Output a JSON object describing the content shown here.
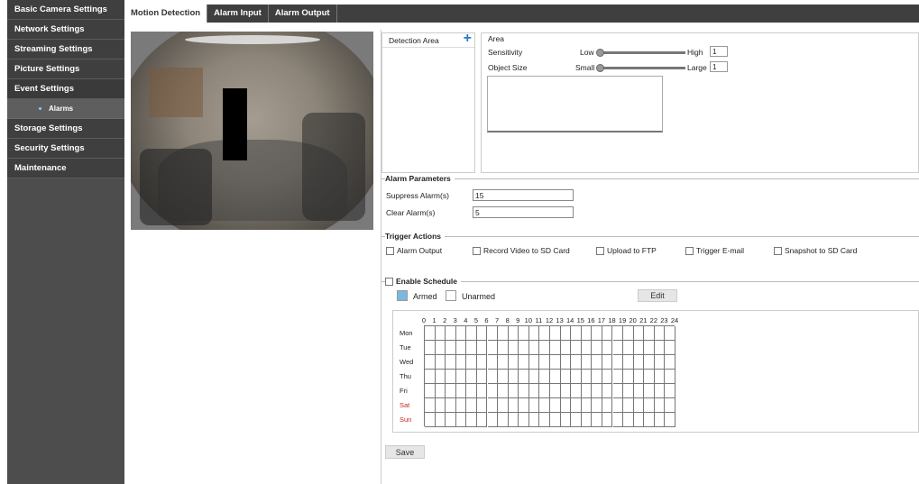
{
  "sidebar": {
    "items": [
      {
        "label": "Basic Camera Settings"
      },
      {
        "label": "Network Settings"
      },
      {
        "label": "Streaming Settings"
      },
      {
        "label": "Picture Settings"
      },
      {
        "label": "Event Settings"
      }
    ],
    "sub_item": {
      "label": "Alarms"
    },
    "items_after": [
      {
        "label": "Storage Settings"
      },
      {
        "label": "Security Settings"
      },
      {
        "label": "Maintenance"
      }
    ]
  },
  "tabs": [
    {
      "label": "Motion Detection",
      "active": true
    },
    {
      "label": "Alarm Input",
      "active": false
    },
    {
      "label": "Alarm Output",
      "active": false
    }
  ],
  "detection": {
    "list_header": "Detection Area",
    "add_glyph": "+",
    "area_label": "Area",
    "sensitivity_label": "Sensitivity",
    "sensitivity_low": "Low",
    "sensitivity_high": "High",
    "sensitivity_value": "1",
    "object_size_label": "Object Size",
    "object_size_small": "Small",
    "object_size_large": "Large",
    "object_size_value": "1"
  },
  "alarm_parameters": {
    "title": "Alarm Parameters",
    "suppress_label": "Suppress Alarm(s)",
    "suppress_value": "15",
    "clear_label": "Clear Alarm(s)",
    "clear_value": "5"
  },
  "trigger_actions": {
    "title": "Trigger Actions",
    "options": [
      "Alarm Output",
      "Record Video to SD Card",
      "Upload to FTP",
      "Trigger E-mail",
      "Snapshot to SD Card"
    ]
  },
  "schedule": {
    "enable_label": "Enable Schedule",
    "armed_label": "Armed",
    "unarmed_label": "Unarmed",
    "edit_label": "Edit",
    "hours": [
      "0",
      "1",
      "2",
      "3",
      "4",
      "5",
      "6",
      "7",
      "8",
      "9",
      "10",
      "11",
      "12",
      "13",
      "14",
      "15",
      "16",
      "17",
      "18",
      "19",
      "20",
      "21",
      "22",
      "23",
      "24"
    ],
    "days": [
      "Mon",
      "Tue",
      "Wed",
      "Thu",
      "Fri",
      "Sat",
      "Sun"
    ],
    "weekend_color": "#cc2222",
    "armed_color": "#79b8e0"
  },
  "save_label": "Save",
  "colors": {
    "sidebar_bg": "#3f3f3f",
    "accent": "#2a7ac8"
  }
}
